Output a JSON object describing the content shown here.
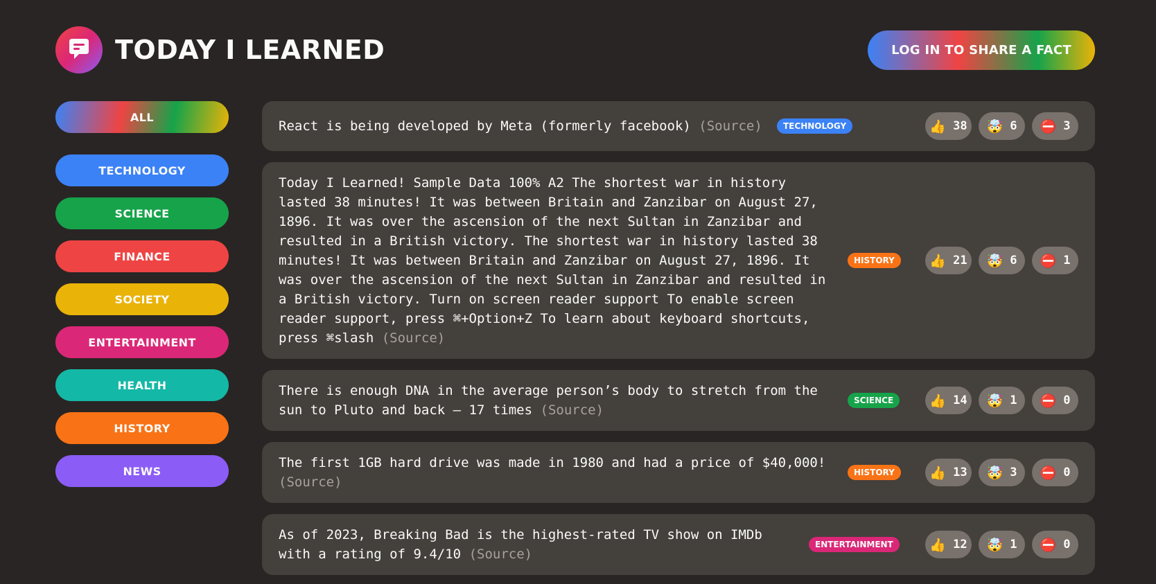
{
  "header": {
    "title": "Today I Learned",
    "login_label": "Log in to share a fact"
  },
  "categories": [
    {
      "label": "All",
      "color": "gradient"
    },
    {
      "label": "technology",
      "color": "#3b82f6"
    },
    {
      "label": "science",
      "color": "#16a34a"
    },
    {
      "label": "finance",
      "color": "#ef4444"
    },
    {
      "label": "society",
      "color": "#eab308"
    },
    {
      "label": "entertainment",
      "color": "#db2777"
    },
    {
      "label": "health",
      "color": "#14b8a6"
    },
    {
      "label": "history",
      "color": "#f97316"
    },
    {
      "label": "news",
      "color": "#8b5cf6"
    }
  ],
  "facts": [
    {
      "text": "React is being developed by Meta (formerly facebook)",
      "source": "(Source)",
      "category": "technology",
      "category_color": "#3b82f6",
      "votes": {
        "interesting": "38",
        "mindblowing": "6",
        "false": "3"
      }
    },
    {
      "text": "Today I Learned! Sample Data 100% A2 The shortest war in history lasted 38 minutes! It was between Britain and Zanzibar on August 27, 1896. It was over the ascension of the next Sultan in Zanzibar and resulted in a British victory. The shortest war in history lasted 38 minutes! It was between Britain and Zanzibar on August 27, 1896. It was over the ascension of the next Sultan in Zanzibar and resulted in a British victory. Turn on screen reader support To enable screen reader support, press ⌘+Option+Z To learn about keyboard shortcuts, press ⌘slash",
      "source": "(Source)",
      "category": "history",
      "category_color": "#f97316",
      "votes": {
        "interesting": "21",
        "mindblowing": "6",
        "false": "1"
      }
    },
    {
      "text": "There is enough DNA in the average person’s body to stretch from the sun to Pluto and back — 17 times",
      "source": "(Source)",
      "category": "science",
      "category_color": "#16a34a",
      "votes": {
        "interesting": "14",
        "mindblowing": "1",
        "false": "0"
      }
    },
    {
      "text": "The first 1GB hard drive was made in 1980 and had a price of $40,000!",
      "source": "(Source)",
      "category": "history",
      "category_color": "#f97316",
      "votes": {
        "interesting": "13",
        "mindblowing": "3",
        "false": "0"
      }
    },
    {
      "text": "As of 2023, Breaking Bad is the highest-rated TV show on IMDb with a rating of 9.4/10",
      "source": "(Source)",
      "category": "entertainment",
      "category_color": "#db2777",
      "votes": {
        "interesting": "12",
        "mindblowing": "1",
        "false": "0"
      }
    }
  ],
  "icons": {
    "logo": "chat-bubble-icon",
    "interesting": "👍",
    "mindblowing": "🤯",
    "false": "⛔️"
  }
}
